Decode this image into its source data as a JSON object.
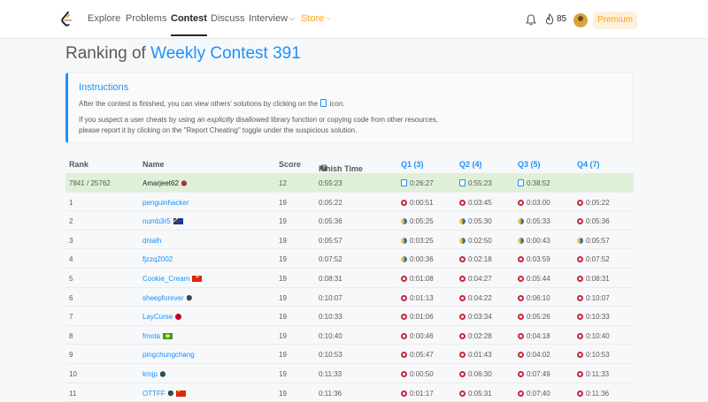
{
  "nav": {
    "items": [
      "Explore",
      "Problems",
      "Contest",
      "Discuss",
      "Interview",
      "Store"
    ],
    "streak_count": "85",
    "premium_label": "Premium"
  },
  "page": {
    "title_prefix": "Ranking of",
    "contest_name": "Weekly Contest 391"
  },
  "instructions": {
    "title": "Instructions",
    "line1_before": "After the contest is finished, you can view others' solutions by clicking on the",
    "line1_after": "icon.",
    "line2_before": "If you suspect a user cheats by using an",
    "line2_em": "explicitly",
    "line2_after": "disallowed library function or copying code from other resources,",
    "line3": "please report it by clicking on the \"Report Cheating\" toggle under the suspicious solution."
  },
  "table": {
    "headers": {
      "rank": "Rank",
      "name": "Name",
      "score": "Score",
      "finish": "Finish Time",
      "q1": "Q1 (3)",
      "q2": "Q2 (4)",
      "q3": "Q3 (5)",
      "q4": "Q4 (7)"
    },
    "rows": [
      {
        "rank": "7841 / 25762",
        "name": "Amarjeet62",
        "badge": "red-gem",
        "flag": "",
        "score": "12",
        "finish": "0:55:23",
        "q1": {
          "time": "0:26:27",
          "lang": "doc"
        },
        "q2": {
          "time": "0:55:23",
          "lang": "doc"
        },
        "q3": {
          "time": "0:38:52",
          "lang": "doc"
        },
        "q4": {
          "time": "",
          "lang": ""
        }
      },
      {
        "rank": "1",
        "name": "penguinhacker",
        "badge": "",
        "flag": "",
        "score": "19",
        "finish": "0:05:22",
        "q1": {
          "time": "0:00:51",
          "lang": "cpp"
        },
        "q2": {
          "time": "0:03:45",
          "lang": "cpp"
        },
        "q3": {
          "time": "0:03:00",
          "lang": "cpp"
        },
        "q4": {
          "time": "0:05:22",
          "lang": "cpp"
        }
      },
      {
        "rank": "2",
        "name": "numb3r5",
        "badge": "",
        "flag": "au",
        "score": "19",
        "finish": "0:05:36",
        "q1": {
          "time": "0:05:25",
          "lang": "python"
        },
        "q2": {
          "time": "0:05:30",
          "lang": "python"
        },
        "q3": {
          "time": "0:05:33",
          "lang": "python"
        },
        "q4": {
          "time": "0:05:36",
          "lang": "cpp"
        }
      },
      {
        "rank": "3",
        "name": "dnialh",
        "badge": "",
        "flag": "",
        "score": "19",
        "finish": "0:05:57",
        "q1": {
          "time": "0:03:25",
          "lang": "python"
        },
        "q2": {
          "time": "0:02:50",
          "lang": "python"
        },
        "q3": {
          "time": "0:00:43",
          "lang": "python"
        },
        "q4": {
          "time": "0:05:57",
          "lang": "python"
        }
      },
      {
        "rank": "4",
        "name": "fjzzq2002",
        "badge": "",
        "flag": "",
        "score": "19",
        "finish": "0:07:52",
        "q1": {
          "time": "0:00:36",
          "lang": "python"
        },
        "q2": {
          "time": "0:02:18",
          "lang": "cpp"
        },
        "q3": {
          "time": "0:03:59",
          "lang": "cpp"
        },
        "q4": {
          "time": "0:07:52",
          "lang": "cpp"
        }
      },
      {
        "rank": "5",
        "name": "Cookie_Cream",
        "badge": "",
        "flag": "vn",
        "score": "19",
        "finish": "0:08:31",
        "q1": {
          "time": "0:01:08",
          "lang": "cpp"
        },
        "q2": {
          "time": "0:04:27",
          "lang": "cpp"
        },
        "q3": {
          "time": "0:05:44",
          "lang": "cpp"
        },
        "q4": {
          "time": "0:08:31",
          "lang": "cpp"
        }
      },
      {
        "rank": "6",
        "name": "sheepforever",
        "badge": "gem",
        "flag": "",
        "score": "19",
        "finish": "0:10:07",
        "q1": {
          "time": "0:01:13",
          "lang": "cpp"
        },
        "q2": {
          "time": "0:04:22",
          "lang": "cpp"
        },
        "q3": {
          "time": "0:06:10",
          "lang": "cpp"
        },
        "q4": {
          "time": "0:10:07",
          "lang": "cpp"
        }
      },
      {
        "rank": "7",
        "name": "LayCurse",
        "badge": "",
        "flag": "jp",
        "score": "19",
        "finish": "0:10:33",
        "q1": {
          "time": "0:01:06",
          "lang": "cpp"
        },
        "q2": {
          "time": "0:03:34",
          "lang": "cpp"
        },
        "q3": {
          "time": "0:05:26",
          "lang": "cpp"
        },
        "q4": {
          "time": "0:10:33",
          "lang": "cpp"
        }
      },
      {
        "rank": "8",
        "name": "fmota",
        "badge": "",
        "flag": "br",
        "score": "19",
        "finish": "0:10:40",
        "q1": {
          "time": "0:00:46",
          "lang": "cpp"
        },
        "q2": {
          "time": "0:02:28",
          "lang": "cpp"
        },
        "q3": {
          "time": "0:04:18",
          "lang": "cpp"
        },
        "q4": {
          "time": "0:10:40",
          "lang": "cpp"
        }
      },
      {
        "rank": "9",
        "name": "pingchungchang",
        "badge": "",
        "flag": "",
        "score": "19",
        "finish": "0:10:53",
        "q1": {
          "time": "0:05:47",
          "lang": "cpp"
        },
        "q2": {
          "time": "0:01:43",
          "lang": "cpp"
        },
        "q3": {
          "time": "0:04:02",
          "lang": "cpp"
        },
        "q4": {
          "time": "0:10:53",
          "lang": "cpp"
        }
      },
      {
        "rank": "10",
        "name": "kmjp",
        "badge": "gem",
        "flag": "",
        "score": "19",
        "finish": "0:11:33",
        "q1": {
          "time": "0:00:50",
          "lang": "cpp"
        },
        "q2": {
          "time": "0:06:30",
          "lang": "cpp"
        },
        "q3": {
          "time": "0:07:49",
          "lang": "cpp"
        },
        "q4": {
          "time": "0:11:33",
          "lang": "cpp"
        }
      },
      {
        "rank": "11",
        "name": "OTTFF",
        "badge": "gem",
        "flag": "cn",
        "score": "19",
        "finish": "0:11:36",
        "q1": {
          "time": "0:01:17",
          "lang": "cpp"
        },
        "q2": {
          "time": "0:05:31",
          "lang": "cpp"
        },
        "q3": {
          "time": "0:07:40",
          "lang": "cpp"
        },
        "q4": {
          "time": "0:11:36",
          "lang": "cpp"
        }
      }
    ]
  },
  "colors": {
    "accent": "#1a90ff",
    "store": "#ffa116",
    "highlight_row": "#dff0d8",
    "cpp": "#c5283d"
  }
}
